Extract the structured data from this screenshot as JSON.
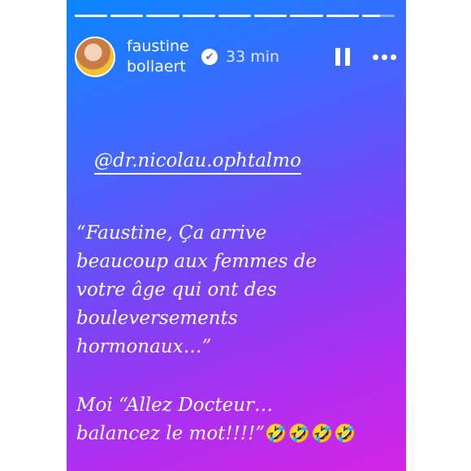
{
  "story": {
    "progress": {
      "total_segments": 9,
      "completed": 8,
      "current_fraction": 0.55
    },
    "user": {
      "first_name": "faustine",
      "last_name": "bollaert",
      "verified_badge": "✔",
      "time_ago": "33 min"
    },
    "controls": {
      "pause_icon": "pause-icon",
      "more_icon": "more-options-icon"
    },
    "mention": "@dr.nicolau.ophtalmo",
    "quote": "“Faustine, Ça arrive\nbeaucoup aux femmes de\nvotre âge qui ont des\nbouleversements\nhormonaux…”",
    "reply_text": "Moi “Allez Docteur…\nbalancez le mot!!!!”",
    "reply_emoji": "🤣🤣🤣🤣",
    "colors": {
      "gradient_top": "#0a86ff",
      "gradient_bottom": "#d425e6",
      "text": "#ffffff"
    }
  }
}
